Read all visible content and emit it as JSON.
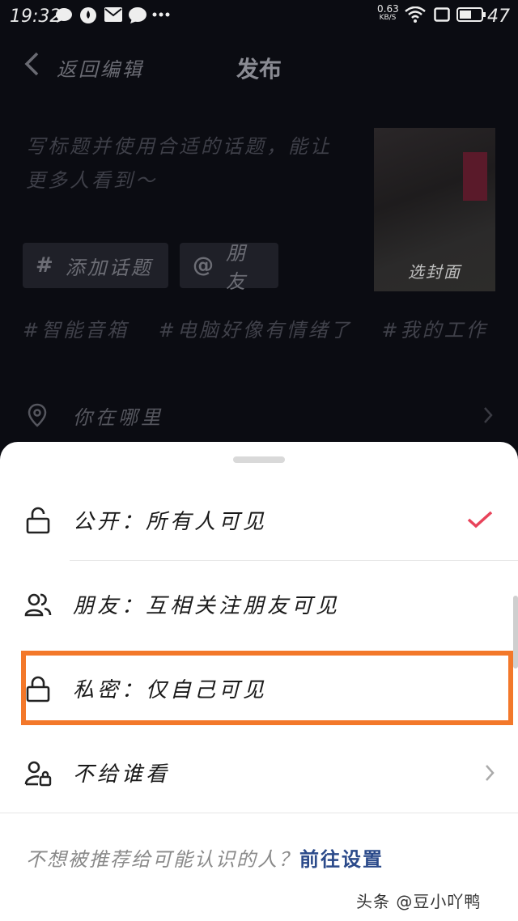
{
  "status_bar": {
    "time": "19:32",
    "net_speed_value": "0.63",
    "net_speed_unit": "KB/S",
    "battery": "47",
    "icons": [
      "chat-bubble-icon",
      "water-drop-icon",
      "mail-icon",
      "message-icon",
      "more-dots-icon",
      "wifi-icon",
      "screen-icon",
      "battery-icon"
    ]
  },
  "header": {
    "back_label": "返回编辑",
    "title": "发布"
  },
  "post": {
    "caption_placeholder": "写标题并使用合适的话题，能让更多人看到～",
    "cover_label": "选封面"
  },
  "chips": {
    "topic_symbol": "#",
    "topic_label": "添加话题",
    "friend_symbol": "@",
    "friend_label": "朋友"
  },
  "suggested_tags": [
    "#智能音箱",
    "#电脑好像有情绪了",
    "#我的工作"
  ],
  "location": {
    "label": "你在哪里"
  },
  "visibility_sheet": {
    "options": [
      {
        "label": "公开：所有人可见",
        "icon": "unlock-icon",
        "selected": true
      },
      {
        "label": "朋友：互相关注朋友可见",
        "icon": "friends-icon",
        "selected": false
      },
      {
        "label": "私密：仅自己可见",
        "icon": "lock-icon",
        "selected": false
      },
      {
        "label": "不给谁看",
        "icon": "user-lock-icon",
        "selected": false
      }
    ],
    "footer_text": "不想被推荐给可能认识的人？",
    "footer_link": "前往设置",
    "check_color": "#e8435a",
    "highlight_color": "#f3782a"
  },
  "watermark": "头条 @豆小吖鸭"
}
